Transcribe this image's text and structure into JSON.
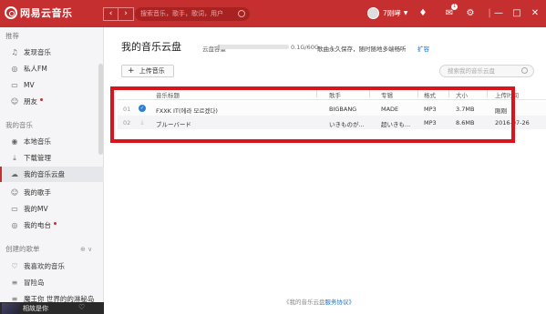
{
  "app": {
    "title": "网易云音乐"
  },
  "search": {
    "placeholder": "搜索音乐，歌手，歌词，用户"
  },
  "user": {
    "name": "7刚哮"
  },
  "topbar": {
    "mail_badge": "1"
  },
  "sidebar": {
    "recommend_title": "推荐",
    "recommend_items": [
      {
        "label": "发现音乐",
        "icon": "music-note-icon"
      },
      {
        "label": "私人FM",
        "icon": "radio-icon"
      },
      {
        "label": "MV",
        "icon": "video-icon"
      },
      {
        "label": "朋友",
        "icon": "friends-icon"
      }
    ],
    "my_music_title": "我的音乐",
    "my_music_items": [
      {
        "label": "本地音乐",
        "icon": "local-music-icon"
      },
      {
        "label": "下载管理",
        "icon": "download-icon"
      },
      {
        "label": "我的音乐云盘",
        "icon": "cloud-icon"
      },
      {
        "label": "我的歌手",
        "icon": "singer-icon"
      },
      {
        "label": "我的MV",
        "icon": "video-icon"
      },
      {
        "label": "我的电台",
        "icon": "radio-station-icon"
      }
    ],
    "created_title": "创建的歌单",
    "created_items": [
      {
        "label": "我喜欢的音乐",
        "icon": "heart-icon"
      },
      {
        "label": "冒险岛",
        "icon": "playlist-icon"
      },
      {
        "label": "魔王你 世界的的淋秘岛",
        "icon": "playlist-icon"
      }
    ]
  },
  "now_playing": {
    "title": "相故是你"
  },
  "main": {
    "title": "我的音乐云盘",
    "quota_label": "云盘容量",
    "quota_value": "0.1G/60G",
    "quota_fraction": 0.02,
    "quota_note": "歌曲永久保存，随时随地多端畅听",
    "expand_label": "扩容",
    "upload_label": "上传音乐",
    "cloud_search_placeholder": "搜索我的音乐云盘",
    "footer_prefix": "《我的音乐云盘",
    "footer_link": "服务协议》"
  },
  "table": {
    "headers": [
      "音乐标题",
      "歌手",
      "专辑",
      "格式",
      "大小",
      "上传时间"
    ],
    "rows": [
      {
        "num": "01",
        "title": "FXXK IT(에라 모르겠다)",
        "artist": "BIGBANG",
        "album": "MADE",
        "format": "MP3",
        "size": "3.7MB",
        "time": "刚刚",
        "status": "uploaded"
      },
      {
        "num": "02",
        "title": "ブルーバード",
        "artist": "いきものが...",
        "album": "超いきも...",
        "format": "MP3",
        "size": "8.6MB",
        "time": "2016-07-26",
        "status": "downloadable"
      }
    ]
  },
  "colors": {
    "brand": "#c62f2f",
    "highlight": "#d8141c",
    "link": "#1a70c9"
  }
}
